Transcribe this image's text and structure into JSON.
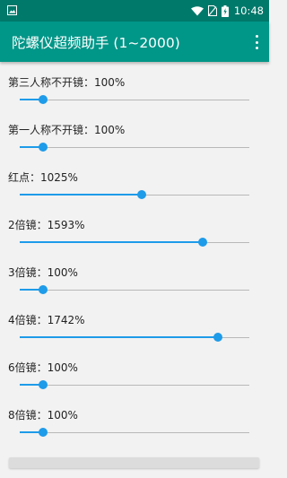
{
  "status_bar": {
    "time": "10:48",
    "icons": [
      "gallery-icon",
      "wifi-icon",
      "no-sim-icon",
      "battery-charging-icon"
    ]
  },
  "app_bar": {
    "title": "陀螺仪超频助手 (1~2000)",
    "menu_icon": "overflow-menu-icon"
  },
  "colors": {
    "status_bar": "#00796b",
    "app_bar": "#009688",
    "accent": "#1e9be9",
    "track": "#b8b8b8",
    "background": "#f2f2f2"
  },
  "slider_range": {
    "min": 1,
    "max": 2000
  },
  "settings": [
    {
      "label": "第三人称不开镜：100%",
      "value": 100
    },
    {
      "label": "第一人称不开镜：100%",
      "value": 100
    },
    {
      "label": "红点：1025%",
      "value": 1025
    },
    {
      "label": "2倍镜：1593%",
      "value": 1593
    },
    {
      "label": "3倍镜：100%",
      "value": 100
    },
    {
      "label": "4倍镜：1742%",
      "value": 1742
    },
    {
      "label": "6倍镜：100%",
      "value": 100
    },
    {
      "label": "8倍镜：100%",
      "value": 100
    }
  ]
}
